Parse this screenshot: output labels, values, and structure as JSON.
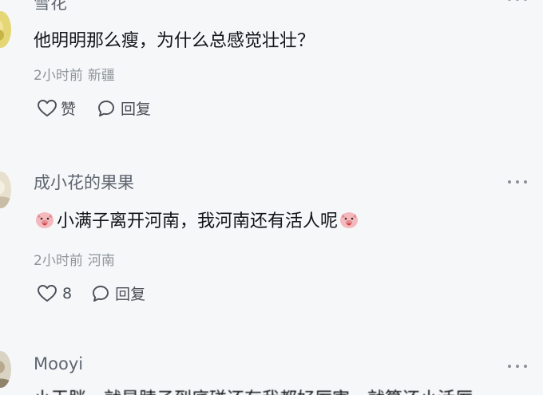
{
  "comments": [
    {
      "author": "雪花",
      "text": "他明明那么瘦，为什么总感觉壮壮？",
      "time": "2小时前",
      "location": "新疆",
      "like_label": "赞",
      "reply_label": "回复"
    },
    {
      "author": "成小花的果果",
      "text": "小满子离开河南，我河南还有活人呢",
      "time": "2小时前",
      "location": "河南",
      "like_label": "8",
      "reply_label": "回复"
    },
    {
      "author": "Mooyi",
      "text": "小王胖，就是脖子到底碰还有我都好厉害，就算还小活厉",
      "time": "",
      "location": ""
    }
  ],
  "icons": {
    "like": "heart-icon",
    "reply": "comment-bubble-icon",
    "more": "more-icon",
    "emoji": "pig-face-emoji-icon"
  },
  "colors": {
    "background": "#f6f7f9",
    "author": "#5f6670",
    "meta": "#8e949b",
    "text": "#111418"
  }
}
